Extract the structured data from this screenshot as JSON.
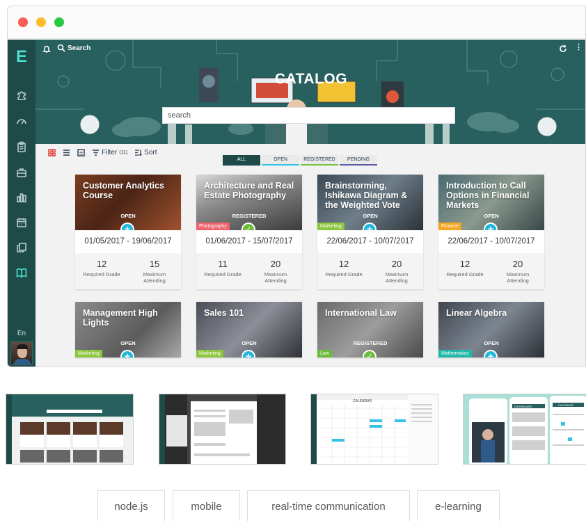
{
  "window": {
    "controls": [
      "close",
      "minimize",
      "maximize"
    ]
  },
  "sidebar": {
    "logo": "E",
    "icons": [
      "puzzle-icon",
      "gauge-icon",
      "clipboard-icon",
      "briefcase-icon",
      "bar-chart-icon",
      "calendar-icon",
      "documents-icon",
      "book-icon"
    ],
    "active": "book-icon",
    "language": "En"
  },
  "header": {
    "search_label": "Search",
    "title": "CATALOG",
    "search_placeholder": "search"
  },
  "toolbar": {
    "filter_label": "Filter",
    "filter_count": "(11)",
    "sort_label": "Sort"
  },
  "tabs": [
    "ALL",
    "OPEN",
    "REGISTERED",
    "PENDING"
  ],
  "courses": [
    {
      "title": "Customer Analytics Course",
      "status": "OPEN",
      "badge": "",
      "dates": "01/05/2017 - 19/06/2017",
      "grade": "12",
      "grade_label": "Required Grade",
      "attending": "15",
      "attending_label": "Maximum Attending"
    },
    {
      "title": "Architecture and Real Estate Photography",
      "status": "REGISTERED",
      "badge": "Photography",
      "badge_color": "#f0626e",
      "dates": "01/06/2017 - 15/07/2017",
      "grade": "11",
      "grade_label": "Required Grade",
      "attending": "20",
      "attending_label": "Maximum Attending"
    },
    {
      "title": "Brainstorming, Ishikawa Diagram & the Weighted Vote",
      "status": "OPEN",
      "badge": "Marketing",
      "badge_color": "#8cc63f",
      "dates": "22/06/2017 - 10/07/2017",
      "grade": "12",
      "grade_label": "Required Grade",
      "attending": "20",
      "attending_label": "Maximum Attending"
    },
    {
      "title": "Introduction to Call Options in Financial Markets",
      "status": "OPEN",
      "badge": "Finance",
      "badge_color": "#f5a623",
      "dates": "22/06/2017 - 10/07/2017",
      "grade": "12",
      "grade_label": "Required Grade",
      "attending": "20",
      "attending_label": "Maximum Attending"
    },
    {
      "title": "Management High Lights",
      "status": "OPEN",
      "badge": "Marketing",
      "badge_color": "#8cc63f"
    },
    {
      "title": "Sales 101",
      "status": "OPEN",
      "badge": "Marketing",
      "badge_color": "#8cc63f"
    },
    {
      "title": "International Law",
      "status": "REGISTERED",
      "badge": "Law",
      "badge_color": "#6cbb3c"
    },
    {
      "title": "Linear Algebra",
      "status": "OPEN",
      "badge": "Mathematics",
      "badge_color": "#1fb7a5"
    }
  ],
  "thumbnails": [
    "catalog-thumbnail",
    "editor-thumbnail",
    "calendar-thumbnail",
    "mobile-thumbnail"
  ],
  "thumbnail_texts": {
    "calendar": "CALENDAR",
    "dashboard": "DASHBOARD"
  },
  "tags": [
    "node.js",
    "mobile",
    "real-time communication",
    "e-learning"
  ]
}
